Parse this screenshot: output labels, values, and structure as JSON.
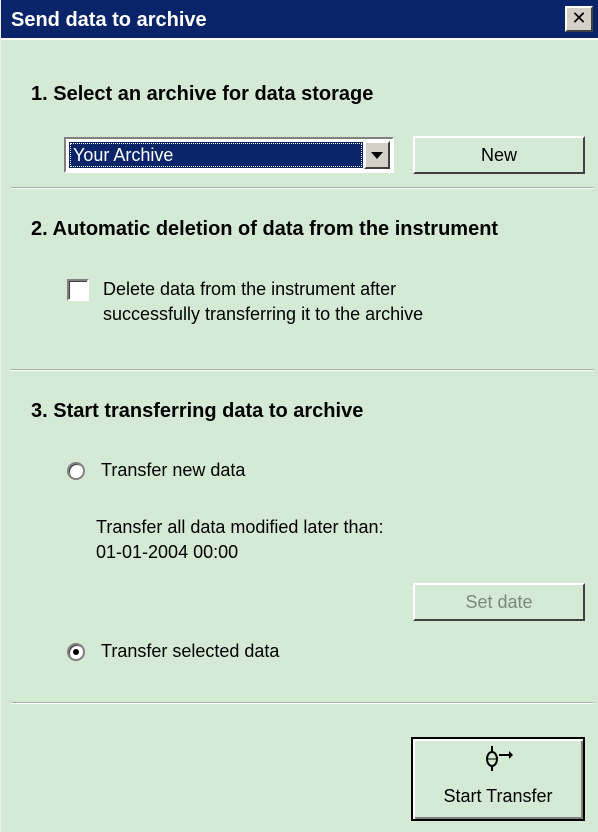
{
  "window": {
    "title": "Send data to archive",
    "close_symbol": "✕"
  },
  "section1": {
    "heading": "1.  Select an archive for data storage",
    "archive_select": {
      "selected": "Your Archive"
    },
    "new_button": "New"
  },
  "section2": {
    "heading": "2.  Automatic deletion of data from the instrument",
    "delete_checkbox": {
      "checked": false,
      "label_line1": "Delete data from the instrument after",
      "label_line2": "successfully transferring it to the archive"
    }
  },
  "section3": {
    "heading": "3.  Start transferring data to archive",
    "transfer_new": {
      "selected": false,
      "label": "Transfer new data",
      "info_line1": "Transfer all data modified later than:",
      "info_line2": "01-01-2004 00:00"
    },
    "set_date_button": "Set date",
    "transfer_selected": {
      "selected": true,
      "label": "Transfer selected data"
    },
    "start_transfer_button": {
      "label": "Start Transfer",
      "icon": "transfer-arrow-icon"
    }
  },
  "colors": {
    "titlebar": "#0a246a",
    "background": "#d4ead4",
    "selection": "#0a246a"
  }
}
